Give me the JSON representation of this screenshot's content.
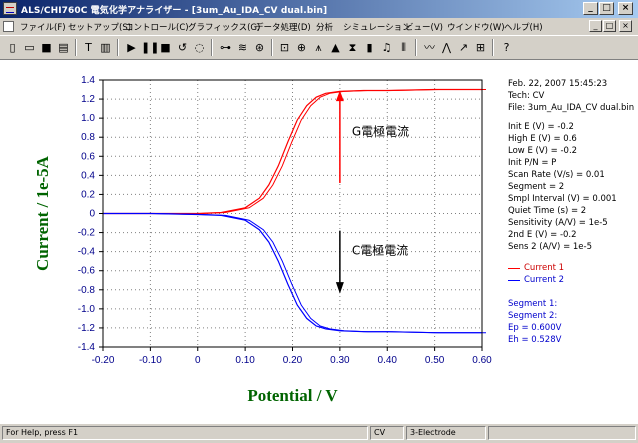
{
  "window": {
    "title": "ALS/CHI760C 電気化学アナライザー - [3um_Au_IDA_CV dual.bin]",
    "controls": [
      "_",
      "□",
      "×"
    ]
  },
  "menu": {
    "items": [
      "ファイル(F)",
      "セットアップ(S)",
      "コントロール(C)",
      "グラフィックス(G)",
      "データ処理(D)",
      "分析",
      "シミュレーション",
      "ビュー(V)",
      "ウインドウ(W)",
      "ヘルプ(H)"
    ],
    "mdi_controls": [
      "_",
      "□",
      "×"
    ]
  },
  "toolbar": {
    "icons": [
      "new-file-icon",
      "open-file-icon",
      "save-icon",
      "print-icon",
      "technique-icon",
      "parameters-icon",
      "run-icon",
      "pause-icon",
      "stop-icon",
      "reverse-icon",
      "ir-comp-icon",
      "filter-icon",
      "cell-icon",
      "graph-icon",
      "zoom-icon",
      "overlay-icon",
      "add-icon",
      "color-icon",
      "font-icon",
      "copy-icon",
      "smooth-icon",
      "derivative-icon",
      "integrate-icon",
      "peak-icon",
      "info-icon",
      "help-icon"
    ]
  },
  "info_panel": {
    "date_line": "Feb. 22, 2007   15:45:23",
    "tech": "Tech: CV",
    "file": "File: 3um_Au_IDA_CV dual.bin",
    "params": [
      "Init E (V) = -0.2",
      "High E (V) = 0.6",
      "Low E (V) = -0.2",
      "Init P/N = P",
      "Scan Rate (V/s) = 0.01",
      "Segment = 2",
      "Smpl Interval (V) = 0.001",
      "Quiet Time (s) = 2",
      "Sensitivity (A/V) = 1e-5",
      "2nd E (V) = -0.2",
      "Sens 2 (A/V) = 1e-5"
    ],
    "legend": [
      {
        "label": "Current 1",
        "color": "#ff0000"
      },
      {
        "label": "Current 2",
        "color": "#0000ff"
      }
    ],
    "segments": [
      "Segment 1:",
      "Segment 2:",
      "Ep = 0.600V",
      "Eh = 0.528V"
    ]
  },
  "annotations": {
    "generator": "G電極電流",
    "collector": "C電極電流"
  },
  "chart_data": {
    "type": "line",
    "xlabel": "Potential / V",
    "ylabel": "Current / 1e-5A",
    "xlim": [
      -0.2,
      0.6
    ],
    "ylim": [
      -1.4,
      1.4
    ],
    "x_ticks": [
      "-0.20",
      "-0.10",
      "0",
      "0.10",
      "0.20",
      "0.30",
      "0.40",
      "0.50",
      "0.60"
    ],
    "y_ticks": [
      "1.4",
      "1.2",
      "1.0",
      "0.8",
      "0.6",
      "0.4",
      "0.2",
      "0",
      "-0.2",
      "-0.4",
      "-0.6",
      "-0.8",
      "-1.0",
      "-1.2",
      "-1.4"
    ],
    "grid": true,
    "series": [
      {
        "name": "Current 1",
        "color": "#ff0000",
        "x": [
          -0.2,
          -0.1,
          0,
          0.05,
          0.1,
          0.13,
          0.15,
          0.17,
          0.19,
          0.21,
          0.23,
          0.25,
          0.27,
          0.3,
          0.35,
          0.4,
          0.5,
          0.6
        ],
        "y": [
          0,
          0,
          0,
          0.01,
          0.06,
          0.16,
          0.3,
          0.5,
          0.75,
          0.98,
          1.13,
          1.22,
          1.26,
          1.28,
          1.29,
          1.29,
          1.3,
          1.3
        ]
      },
      {
        "name": "Current 2",
        "color": "#0000ff",
        "x": [
          -0.2,
          -0.1,
          0,
          0.05,
          0.1,
          0.13,
          0.15,
          0.17,
          0.19,
          0.21,
          0.23,
          0.25,
          0.27,
          0.3,
          0.35,
          0.4,
          0.5,
          0.6
        ],
        "y": [
          0,
          0,
          -0.01,
          -0.02,
          -0.07,
          -0.17,
          -0.3,
          -0.5,
          -0.74,
          -0.96,
          -1.1,
          -1.18,
          -1.21,
          -1.23,
          -1.24,
          -1.24,
          -1.25,
          -1.25
        ]
      }
    ]
  },
  "status": {
    "help": "For Help, press F1",
    "technique": "CV",
    "electrode": "3-Electrode"
  }
}
